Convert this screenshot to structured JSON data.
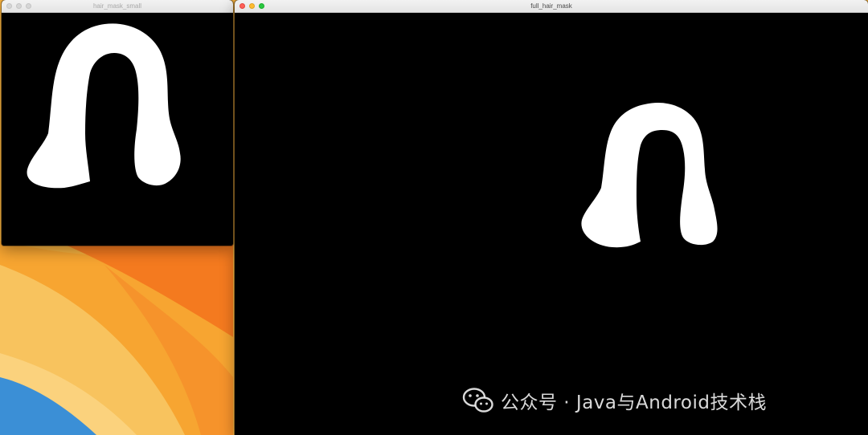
{
  "desktop": {
    "wallpaper_colors": [
      "#f2a33a",
      "#f47b20",
      "#f9c25b",
      "#3b8fd6"
    ]
  },
  "windows": [
    {
      "id": "small",
      "title": "hair_mask_small",
      "state": "inactive",
      "content": "white hair mask silhouette on black background"
    },
    {
      "id": "large",
      "title": "full_hair_mask",
      "state": "active",
      "content": "white hair mask silhouette on black background"
    }
  ],
  "watermark": {
    "icon": "wechat-icon",
    "text": "公众号 · Java与Android技术栈"
  },
  "colors": {
    "mask": "#ffffff",
    "background": "#000000",
    "traffic_close": "#ff5f57",
    "traffic_min": "#febc2e",
    "traffic_max": "#28c840"
  }
}
